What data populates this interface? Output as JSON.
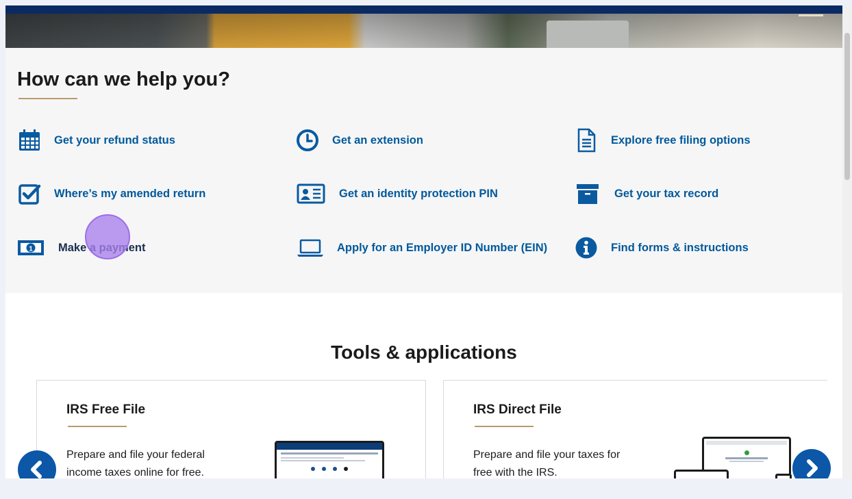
{
  "help": {
    "title": "How can we help you?",
    "links": [
      {
        "label": "Get your refund status",
        "icon": "calendar-icon"
      },
      {
        "label": "Get an extension",
        "icon": "clock-icon"
      },
      {
        "label": "Explore free filing options",
        "icon": "document-icon"
      },
      {
        "label": "Where’s my amended return",
        "icon": "checkbox-icon"
      },
      {
        "label": "Get an identity protection PIN",
        "icon": "id-card-icon"
      },
      {
        "label": "Get your tax record",
        "icon": "archive-box-icon"
      },
      {
        "label": "Make a payment",
        "icon": "money-bill-icon"
      },
      {
        "label": "Apply for an Employer ID Number (EIN)",
        "icon": "laptop-icon"
      },
      {
        "label": "Find forms & instructions",
        "icon": "info-icon"
      }
    ]
  },
  "tools": {
    "title": "Tools & applications",
    "cards": [
      {
        "title": "IRS Free File",
        "text": "Prepare and file your federal income taxes online for free."
      },
      {
        "title": "IRS Direct File",
        "text": "Prepare and file your taxes for free with the IRS."
      }
    ]
  },
  "colors": {
    "link": "#00599c",
    "accent": "#b99b6b",
    "carousel_arrow": "#0c57a8",
    "cursor_highlight": "#a880ec"
  }
}
